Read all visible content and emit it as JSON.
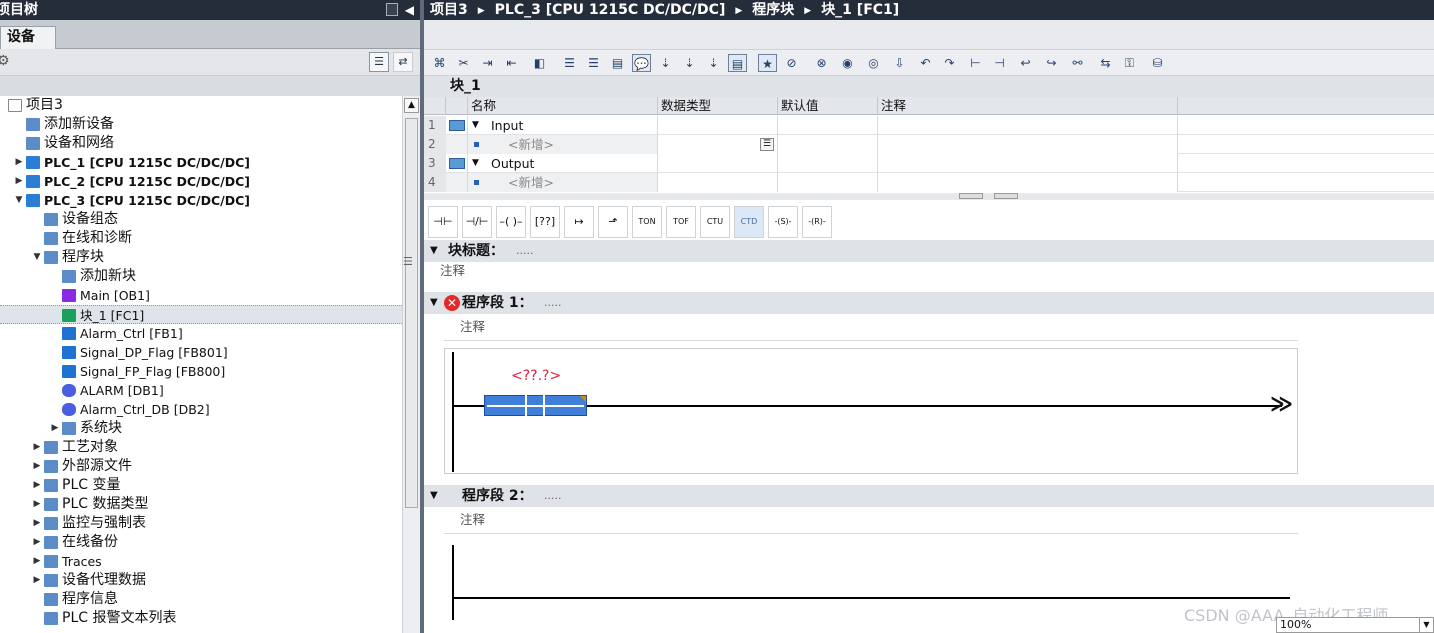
{
  "left": {
    "title": "项目树",
    "tab": "设备",
    "tree": [
      {
        "label": "项目3",
        "icon": "project-icon",
        "indent": 0,
        "arrow": "",
        "name": "tree-item-project3"
      },
      {
        "label": "添加新设备",
        "icon": "add-device-icon",
        "indent": 1,
        "arrow": "",
        "name": "tree-item-add-device"
      },
      {
        "label": "设备和网络",
        "icon": "network-icon",
        "indent": 1,
        "arrow": "",
        "name": "tree-item-devices-networks"
      },
      {
        "label": "PLC_1 [CPU 1215C DC/DC/DC]",
        "icon": "plc-icon",
        "indent": 1,
        "arrow": "▶",
        "bold": true,
        "name": "tree-item-plc1"
      },
      {
        "label": "PLC_2 [CPU 1215C DC/DC/DC]",
        "icon": "plc-icon",
        "indent": 1,
        "arrow": "▶",
        "bold": true,
        "name": "tree-item-plc2"
      },
      {
        "label": "PLC_3 [CPU 1215C DC/DC/DC]",
        "icon": "plc-icon",
        "indent": 1,
        "arrow": "▼",
        "bold": true,
        "name": "tree-item-plc3"
      },
      {
        "label": "设备组态",
        "icon": "device-config-icon",
        "indent": 2,
        "arrow": "",
        "name": "tree-item-device-config"
      },
      {
        "label": "在线和诊断",
        "icon": "diagnostics-icon",
        "indent": 2,
        "arrow": "",
        "name": "tree-item-online-diagnostics"
      },
      {
        "label": "程序块",
        "icon": "folder-icon",
        "indent": 2,
        "arrow": "▼",
        "name": "tree-item-program-blocks"
      },
      {
        "label": "添加新块",
        "icon": "add-block-icon",
        "indent": 3,
        "arrow": "",
        "name": "tree-item-add-block"
      },
      {
        "label": "Main [OB1]",
        "icon": "ob-icon",
        "indent": 3,
        "arrow": "",
        "small": true,
        "name": "tree-item-main-ob1"
      },
      {
        "label": "块_1 [FC1]",
        "icon": "fc-icon",
        "indent": 3,
        "arrow": "",
        "small": true,
        "selected": true,
        "name": "tree-item-block1-fc1"
      },
      {
        "label": "Alarm_Ctrl [FB1]",
        "icon": "fb-icon",
        "indent": 3,
        "arrow": "",
        "small": true,
        "name": "tree-item-alarm-ctrl-fb1"
      },
      {
        "label": "Signal_DP_Flag [FB801]",
        "icon": "fb-icon",
        "indent": 3,
        "arrow": "",
        "small": true,
        "name": "tree-item-signal-dp-flag"
      },
      {
        "label": "Signal_FP_Flag [FB800]",
        "icon": "fb-icon",
        "indent": 3,
        "arrow": "",
        "small": true,
        "name": "tree-item-signal-fp-flag"
      },
      {
        "label": "ALARM [DB1]",
        "icon": "db-icon",
        "indent": 3,
        "arrow": "",
        "small": true,
        "name": "tree-item-alarm-db1"
      },
      {
        "label": "Alarm_Ctrl_DB [DB2]",
        "icon": "db-icon",
        "indent": 3,
        "arrow": "",
        "small": true,
        "name": "tree-item-alarm-ctrl-db2"
      },
      {
        "label": "系统块",
        "icon": "system-block-icon",
        "indent": 3,
        "arrow": "▶",
        "name": "tree-item-system-blocks"
      },
      {
        "label": "工艺对象",
        "icon": "technology-object-icon",
        "indent": 2,
        "arrow": "▶",
        "name": "tree-item-technology-objects"
      },
      {
        "label": "外部源文件",
        "icon": "source-file-icon",
        "indent": 2,
        "arrow": "▶",
        "name": "tree-item-external-sources"
      },
      {
        "label": "PLC 变量",
        "icon": "tag-table-icon",
        "indent": 2,
        "arrow": "▶",
        "name": "tree-item-plc-tags"
      },
      {
        "label": "PLC 数据类型",
        "icon": "data-type-icon",
        "indent": 2,
        "arrow": "▶",
        "name": "tree-item-plc-data-types"
      },
      {
        "label": "监控与强制表",
        "icon": "watch-table-icon",
        "indent": 2,
        "arrow": "▶",
        "name": "tree-item-watch-force-tables"
      },
      {
        "label": "在线备份",
        "icon": "backup-icon",
        "indent": 2,
        "arrow": "▶",
        "name": "tree-item-online-backups"
      },
      {
        "label": "Traces",
        "icon": "trace-icon",
        "indent": 2,
        "arrow": "▶",
        "small": true,
        "name": "tree-item-traces"
      },
      {
        "label": "设备代理数据",
        "icon": "proxy-data-icon",
        "indent": 2,
        "arrow": "▶",
        "name": "tree-item-device-proxy-data"
      },
      {
        "label": "程序信息",
        "icon": "program-info-icon",
        "indent": 2,
        "arrow": "",
        "name": "tree-item-program-info"
      },
      {
        "label": "PLC 报警文本列表",
        "icon": "alarm-text-icon",
        "indent": 2,
        "arrow": "",
        "name": "tree-item-alarm-text-lists"
      }
    ]
  },
  "right": {
    "breadcrumb": [
      "项目3",
      "PLC_3 [CPU 1215C DC/DC/DC]",
      "程序块",
      "块_1 [FC1]"
    ],
    "block_name": "块_1",
    "interface": {
      "headers": [
        "名称",
        "数据类型",
        "默认值",
        "注释"
      ],
      "rows": [
        {
          "num": "1",
          "name": "Input",
          "section": true
        },
        {
          "num": "2",
          "name": "<新增>",
          "section": false
        },
        {
          "num": "3",
          "name": "Output",
          "section": true
        },
        {
          "num": "4",
          "name": "<新增>",
          "section": false
        }
      ]
    },
    "instructions": [
      "⊣⊢",
      "⊣/⊢",
      "–( )–",
      "[??]",
      "↦",
      "⬏",
      "TON",
      "TOF",
      "CTU",
      "CTD",
      "-(S)-",
      "-(R)-"
    ],
    "block_title": {
      "label": "块标题：",
      "dots": ".....",
      "comment": "注释"
    },
    "networks": [
      {
        "label": "程序段 1：",
        "dots": ".....",
        "comment": "注释",
        "operand": "<??.?>",
        "error": true
      },
      {
        "label": "程序段 2：",
        "dots": ".....",
        "comment": "注释",
        "error": false
      }
    ],
    "zoom": "100%",
    "watermark": "CSDN @AAA_自动化工程师"
  },
  "colors": {
    "title_bar": "#262d3a",
    "coil": "#3f7fd9",
    "operand": "#e0203a",
    "error": "#e12a2a"
  }
}
